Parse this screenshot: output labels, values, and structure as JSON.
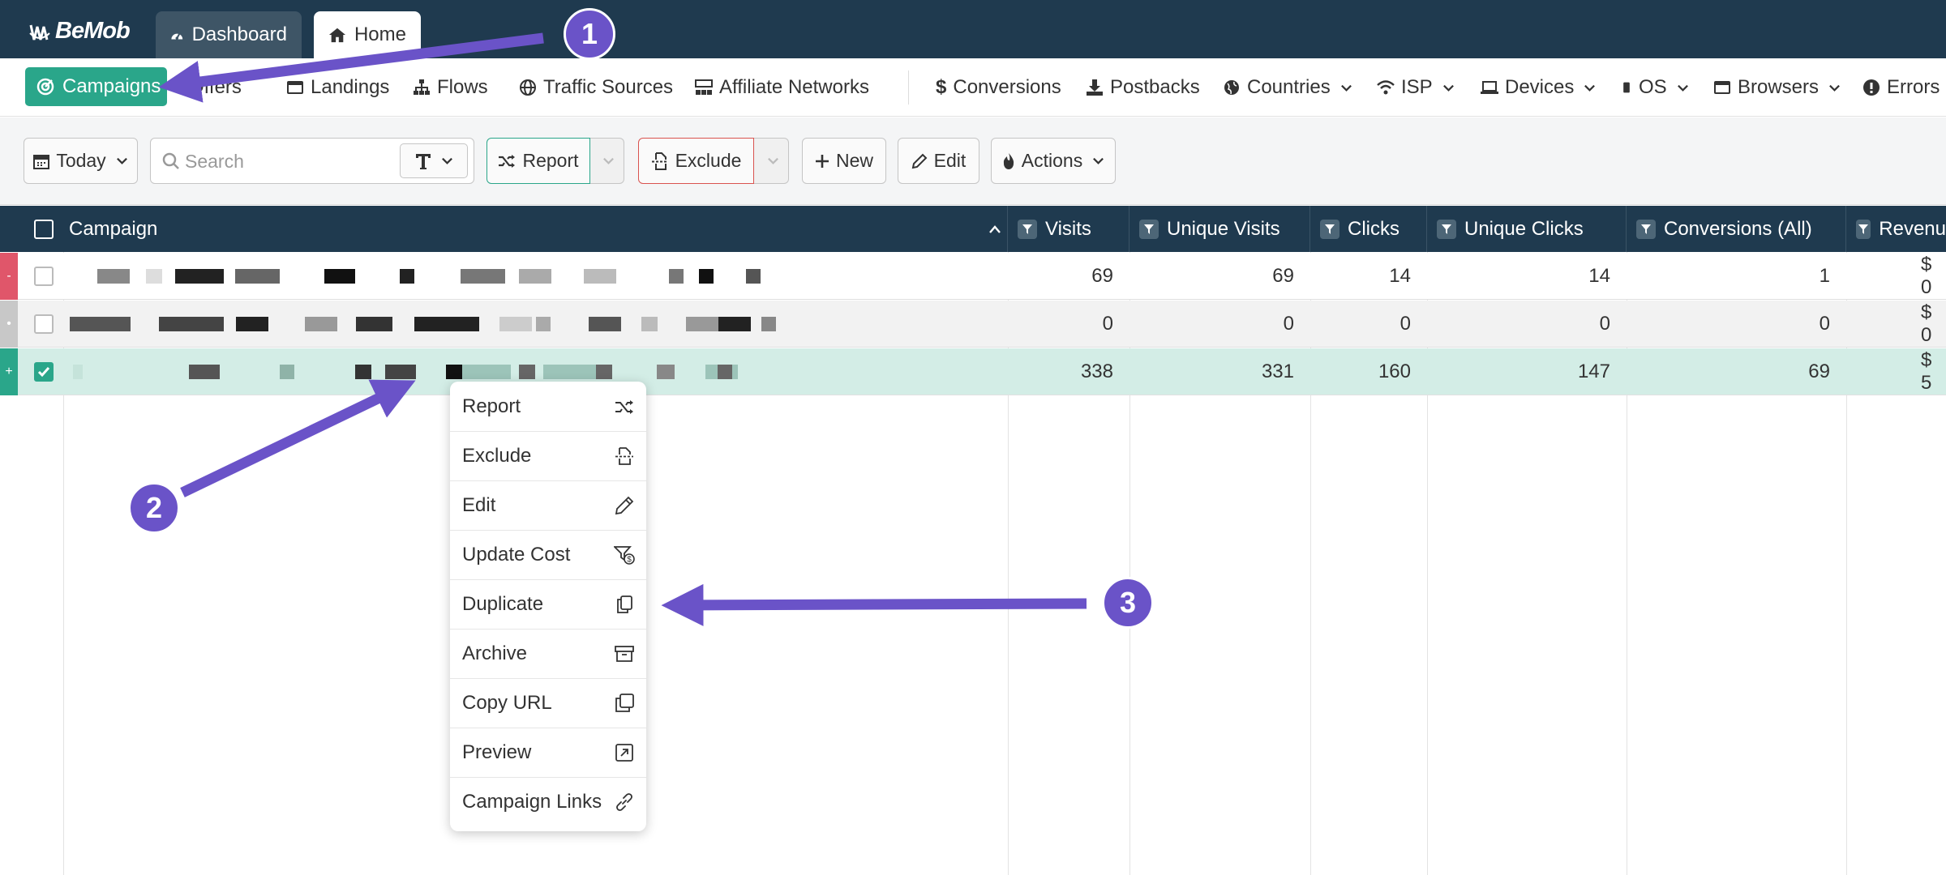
{
  "topbar": {
    "logo_text": "BeMob",
    "tabs": [
      {
        "label": "Dashboard",
        "icon": "gauge-icon"
      },
      {
        "label": "Home",
        "icon": "home-icon"
      }
    ]
  },
  "nav": {
    "items": [
      {
        "label": "Campaigns",
        "icon": "target-icon",
        "active": true
      },
      {
        "label": "Offers",
        "icon": "tag-icon"
      },
      {
        "label": "Landings",
        "icon": "window-icon"
      },
      {
        "label": "Flows",
        "icon": "sitemap-icon"
      },
      {
        "label": "Traffic Sources",
        "icon": "globe-icon"
      },
      {
        "label": "Affiliate Networks",
        "icon": "network-icon"
      },
      {
        "label": "Conversions",
        "icon": "dollar-icon"
      },
      {
        "label": "Postbacks",
        "icon": "download-icon"
      },
      {
        "label": "Countries",
        "icon": "globe-icon"
      },
      {
        "label": "ISP",
        "icon": "wifi-icon"
      },
      {
        "label": "Devices",
        "icon": "laptop-icon"
      },
      {
        "label": "OS",
        "icon": "mobile-icon"
      },
      {
        "label": "Browsers",
        "icon": "window-icon"
      },
      {
        "label": "Errors",
        "icon": "alert-icon"
      }
    ]
  },
  "toolbar": {
    "date_label": "Today",
    "search_placeholder": "Search",
    "report_label": "Report",
    "exclude_label": "Exclude",
    "new_label": "New",
    "edit_label": "Edit",
    "actions_label": "Actions"
  },
  "table": {
    "columns": [
      "Campaign",
      "Visits",
      "Unique Visits",
      "Clicks",
      "Unique Clicks",
      "Conversions (All)",
      "Revenu"
    ],
    "rows": [
      {
        "marker": "-",
        "marker_color": "#e0566a",
        "checked": false,
        "visits": "69",
        "unique_visits": "69",
        "clicks": "14",
        "unique_clicks": "14",
        "conversions": "1",
        "revenue": "$ 0"
      },
      {
        "marker": "•",
        "marker_color": "#c8c8c8",
        "checked": false,
        "visits": "0",
        "unique_visits": "0",
        "clicks": "0",
        "unique_clicks": "0",
        "conversions": "0",
        "revenue": "$ 0"
      },
      {
        "marker": "+",
        "marker_color": "#2aa68a",
        "checked": true,
        "visits": "338",
        "unique_visits": "331",
        "clicks": "160",
        "unique_clicks": "147",
        "conversions": "69",
        "revenue": "$ 5"
      }
    ]
  },
  "context_menu": {
    "items": [
      {
        "label": "Report",
        "icon": "shuffle-icon"
      },
      {
        "label": "Exclude",
        "icon": "exclude-icon"
      },
      {
        "label": "Edit",
        "icon": "pencil-icon"
      },
      {
        "label": "Update Cost",
        "icon": "filter-dollar-icon"
      },
      {
        "label": "Duplicate",
        "icon": "copy-icon"
      },
      {
        "label": "Archive",
        "icon": "archive-icon"
      },
      {
        "label": "Copy URL",
        "icon": "clone-icon"
      },
      {
        "label": "Preview",
        "icon": "external-link-icon"
      },
      {
        "label": "Campaign Links",
        "icon": "link-icon"
      }
    ]
  },
  "annotations": {
    "steps": [
      "1",
      "2",
      "3"
    ],
    "color": "#6a53c8"
  },
  "colors": {
    "topbar": "#1f3a4f",
    "accent": "#2aa68a",
    "selected_row": "#d3ede6",
    "exclude_border": "#d9534f"
  }
}
